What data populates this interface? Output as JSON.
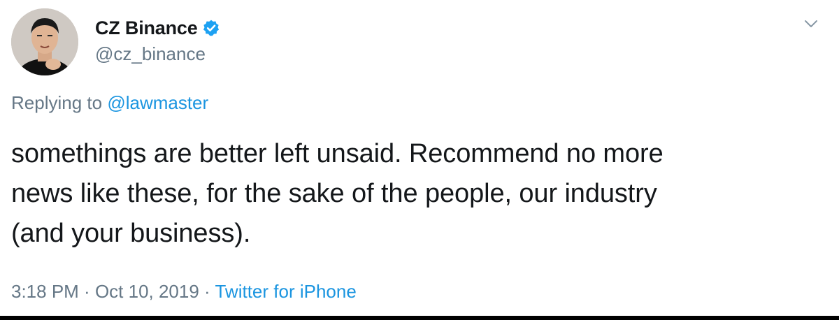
{
  "author": {
    "display_name": "CZ Binance",
    "handle": "@cz_binance",
    "verified": true,
    "verified_color": "#1da1f2",
    "avatar_icon": "user-avatar-photo"
  },
  "reply": {
    "prefix": "Replying to ",
    "target": "@lawmaster"
  },
  "tweet": {
    "text": "somethings are better left unsaid. Recommend no more\nnews like these, for the sake of the people, our industry\n(and your business)."
  },
  "meta": {
    "time": "3:18 PM",
    "separator1": " · ",
    "date": "Oct 10, 2019",
    "separator2": " · ",
    "source": "Twitter for iPhone"
  },
  "icons": {
    "menu": "chevron-down-icon",
    "verified": "verified-badge-icon"
  },
  "colors": {
    "text": "#14171a",
    "secondary": "#657786",
    "link": "#1b95e0"
  }
}
